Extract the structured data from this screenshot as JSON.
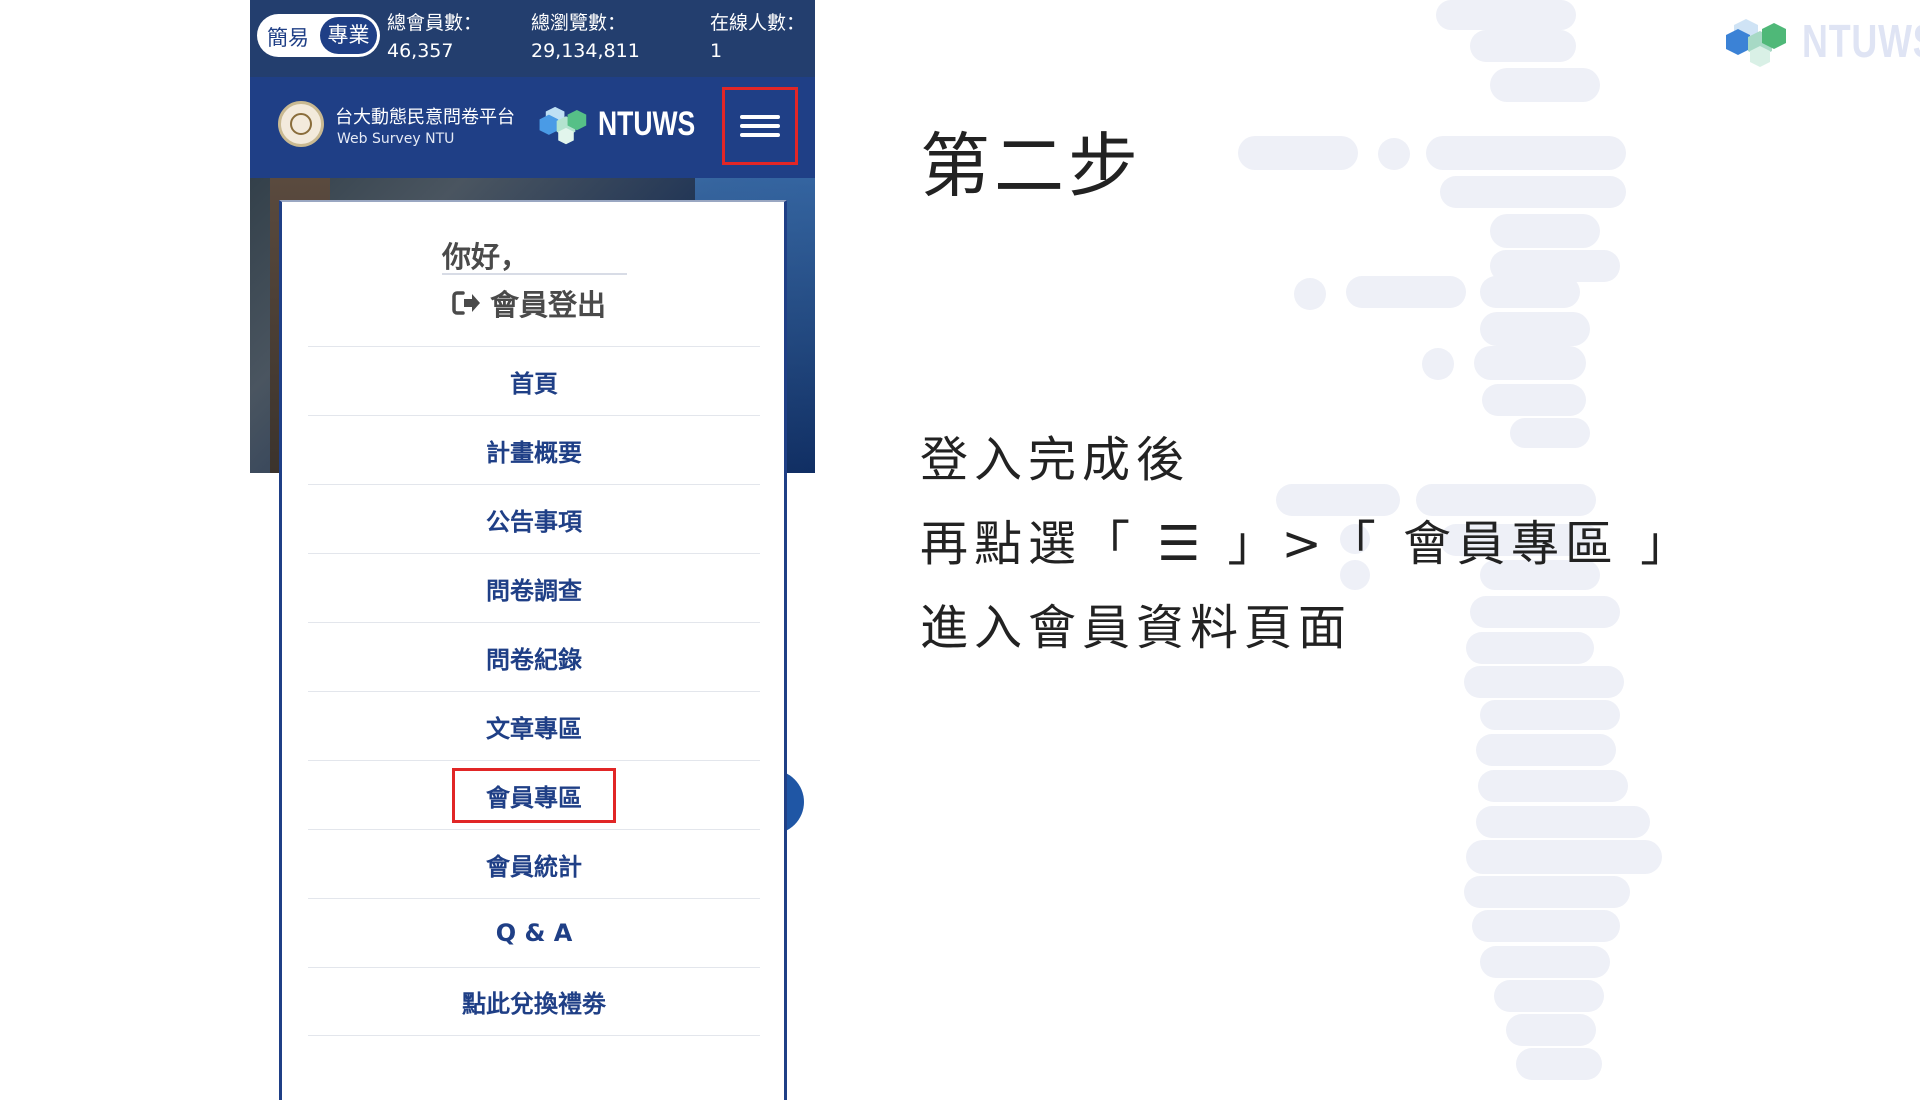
{
  "brand": {
    "name": "NTUWS"
  },
  "phone": {
    "topbar": {
      "toggle": {
        "simple": "簡易",
        "pro": "專業"
      },
      "stats": [
        {
          "label": "總會員數：",
          "value": "46,357"
        },
        {
          "label": "總瀏覽數：",
          "value": "29,134,811"
        },
        {
          "label": "在線人數：",
          "value": "1"
        }
      ]
    },
    "header": {
      "site_name": "台大動態民意問卷平台",
      "site_sub": "Web Survey NTU",
      "logo_text": "NTUWS"
    },
    "menu": {
      "greeting": "你好，",
      "logout": "會員登出",
      "items": [
        {
          "label": "首頁"
        },
        {
          "label": "計畫概要"
        },
        {
          "label": "公告事項"
        },
        {
          "label": "問卷調查"
        },
        {
          "label": "問卷紀錄"
        },
        {
          "label": "文章專區"
        },
        {
          "label": "會員專區"
        },
        {
          "label": "會員統計"
        },
        {
          "label": "Q & A"
        },
        {
          "label": "點此兌換禮劵"
        }
      ]
    }
  },
  "instructions": {
    "step": "第二步",
    "lines": [
      "登入完成後",
      "再點選「 ☰ 」>「 會員專區 」",
      "進入會員資料頁面"
    ]
  },
  "colors": {
    "navy": "#1f3f86",
    "topbar": "#233e6e",
    "highlight": "#e12626"
  },
  "icons": [
    "hex-cluster-logo-icon",
    "university-seal-icon",
    "hamburger-menu-icon",
    "logout-icon"
  ]
}
